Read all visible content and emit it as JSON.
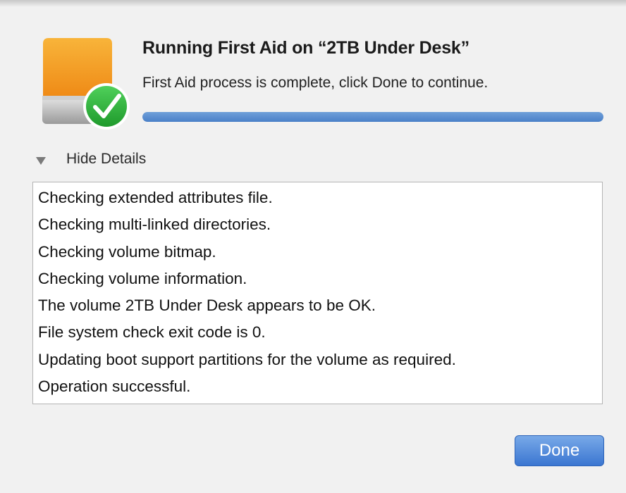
{
  "dialog": {
    "title": "Running First Aid on “2TB Under Desk”",
    "subtitle": "First Aid process is complete, click Done to continue.",
    "progress_percent": 100,
    "icon": "drive-check-icon",
    "accent_color": "#4a80c8"
  },
  "details": {
    "toggle_label": "Hide Details",
    "expanded": true,
    "lines": [
      "Checking extended attributes file.",
      "Checking multi-linked directories.",
      "Checking volume bitmap.",
      "Checking volume information.",
      "The volume 2TB Under Desk appears to be OK.",
      "File system check exit code is 0.",
      "Updating boot support partitions for the volume as required.",
      "Operation successful."
    ]
  },
  "buttons": {
    "done_label": "Done"
  }
}
